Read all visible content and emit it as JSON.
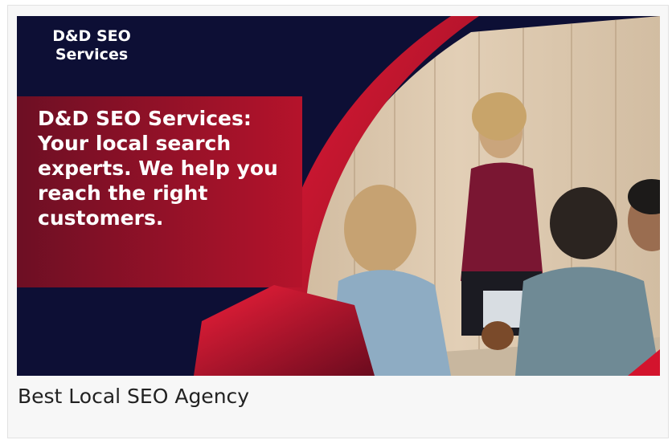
{
  "banner": {
    "brand": "D&D SEO\nServices",
    "headline": "D&D SEO Services: Your local search experts. We help you reach the right customers."
  },
  "caption": "Best Local SEO Agency",
  "colors": {
    "navy": "#0d0f35",
    "crimson": "#b5132b",
    "wall": "#d9c3a8"
  }
}
